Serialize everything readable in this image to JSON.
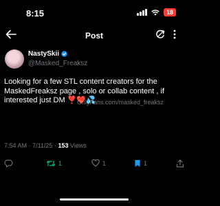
{
  "status": {
    "time": "8:15",
    "battery": "18"
  },
  "header": {
    "title": "Post"
  },
  "author": {
    "name": "NastySkii",
    "handle": "@Masked_Freaksz"
  },
  "post": {
    "text": "Looking for a few STL content creators for the MaskedFreaksz page , solo or collab content , if interested just DM",
    "emojis": "❣️❤️💦",
    "watermark": "OnlyFans.com/masked_freaksz"
  },
  "meta": {
    "time": "7:54 AM",
    "date": "7/11/25",
    "views_count": "153",
    "views_label": "Views",
    "sep": "·"
  },
  "actions": {
    "reply_count": "",
    "repost_count": "1",
    "like_count": "1",
    "bookmark_count": "1"
  },
  "colors": {
    "accent": "#1d9bf0",
    "repost": "#00ba7c",
    "bookmark": "#1d9bf0",
    "battery": "#ff3b30"
  },
  "icons": [
    "back-arrow-icon",
    "refresh-icon",
    "more-icon",
    "verified-icon",
    "reply-icon",
    "repost-icon",
    "like-icon",
    "bookmark-icon",
    "share-icon"
  ]
}
